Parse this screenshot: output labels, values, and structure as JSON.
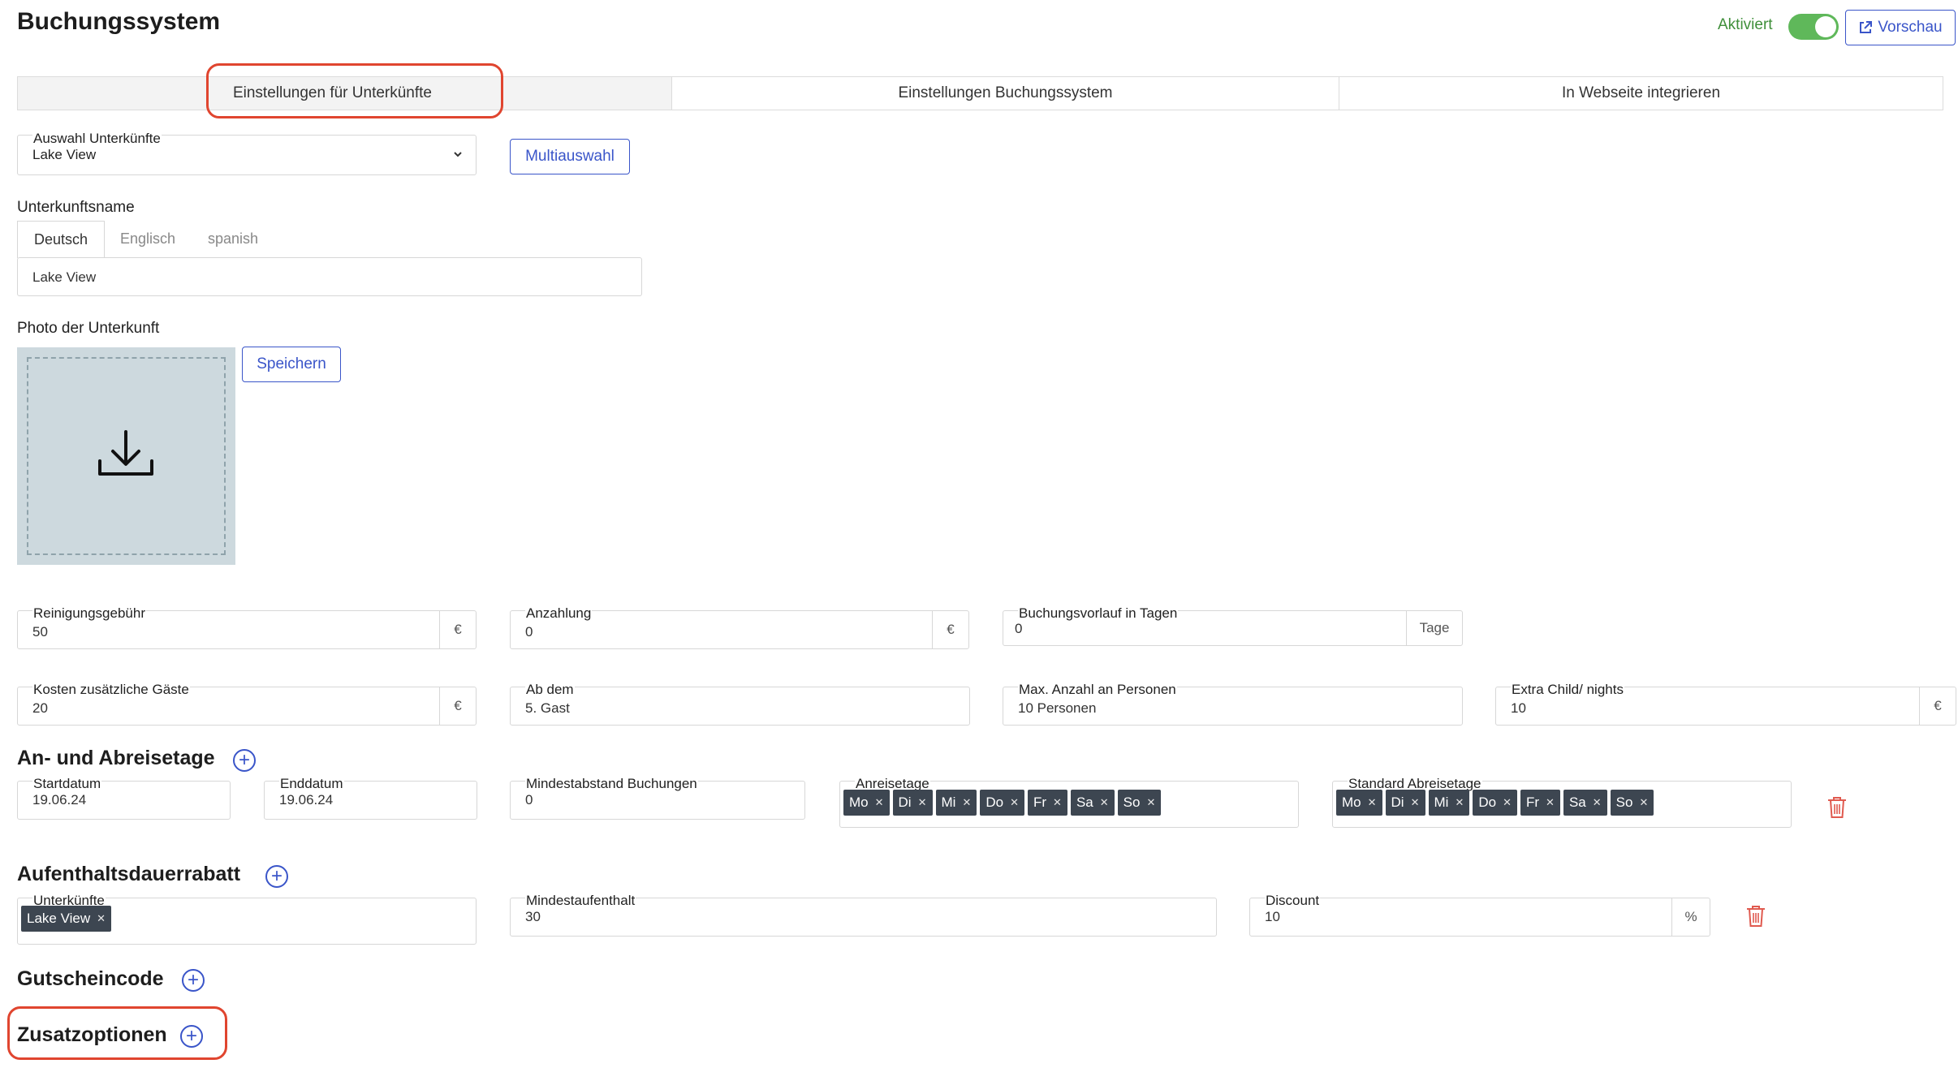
{
  "header": {
    "title": "Buchungssystem",
    "status_label": "Aktiviert",
    "preview_label": "Vorschau"
  },
  "tabs": [
    {
      "label": "Einstellungen für Unterkünfte"
    },
    {
      "label": "Einstellungen Buchungssystem"
    },
    {
      "label": "In Webseite integrieren"
    }
  ],
  "selection": {
    "label": "Auswahl Unterkünfte",
    "value": "Lake View",
    "multi_label": "Multiauswahl"
  },
  "name": {
    "label": "Unterkunftsname",
    "languages": [
      "Deutsch",
      "Englisch",
      "spanish"
    ],
    "value": "Lake View"
  },
  "photo": {
    "label": "Photo der Unterkunft",
    "save_label": "Speichern"
  },
  "fees": {
    "cleaning": {
      "label": "Reinigungsgebühr",
      "value": "50",
      "unit": "€"
    },
    "deposit": {
      "label": "Anzahlung",
      "value": "0",
      "unit": "€"
    },
    "lead": {
      "label": "Buchungsvorlauf in Tagen",
      "value": "0",
      "unit": "Tage"
    },
    "extra_guests": {
      "label": "Kosten zusätzliche Gäste",
      "value": "20",
      "unit": "€"
    },
    "from_guest": {
      "label": "Ab dem",
      "value": "5. Gast"
    },
    "max_persons": {
      "label": "Max. Anzahl an Personen",
      "value": "10 Personen"
    },
    "extra_child": {
      "label": "Extra Child/ nights",
      "value": "10",
      "unit": "€"
    }
  },
  "arrival": {
    "heading": "An- und Abreisetage",
    "start_label": "Startdatum",
    "start_value": "19.06.24",
    "end_label": "Enddatum",
    "end_value": "19.06.24",
    "min_gap_label": "Mindestabstand Buchungen",
    "min_gap_value": "0",
    "arrival_days_label": "Anreisetage",
    "departure_days_label": "Standard Abreisetage",
    "days": [
      "Mo",
      "Di",
      "Mi",
      "Do",
      "Fr",
      "Sa",
      "So"
    ]
  },
  "stay_discount": {
    "heading": "Aufenthaltsdauerrabatt",
    "units_label": "Unterkünfte",
    "units_chip": "Lake View",
    "min_stay_label": "Mindestaufenthalt",
    "min_stay_value": "30",
    "discount_label": "Discount",
    "discount_value": "10",
    "discount_unit": "%"
  },
  "voucher": {
    "heading": "Gutscheincode"
  },
  "extras": {
    "heading": "Zusatzoptionen"
  },
  "colors": {
    "accent": "#3a55c9",
    "active": "#5fb85a",
    "highlight": "#e0452f",
    "delete": "#e05a4f",
    "chip": "#3d4651"
  }
}
